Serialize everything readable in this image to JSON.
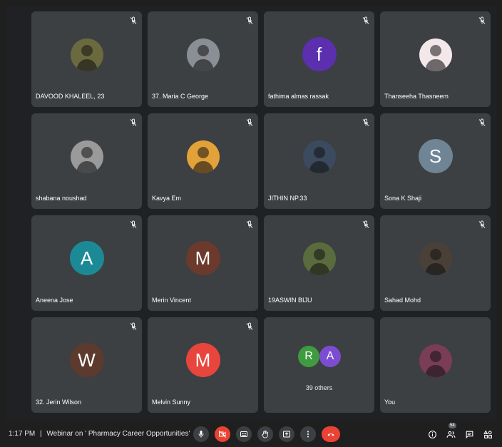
{
  "participants": [
    {
      "name": "DAVOOD KHALEEL, 23",
      "avatar": "photo",
      "color": "#6b6a3f"
    },
    {
      "name": "37. Maria C George",
      "avatar": "photo",
      "color": "#8a8f96"
    },
    {
      "name": "fathima almas rassak",
      "avatar": "letter",
      "letter": "f",
      "color": "#5b2fae"
    },
    {
      "name": "Thanseeha Thasneem",
      "avatar": "photo",
      "color": "#f3e7ea"
    },
    {
      "name": "shabana noushad",
      "avatar": "photo",
      "color": "#9a9a9a"
    },
    {
      "name": "Kavya Em",
      "avatar": "photo",
      "color": "#e3a13a"
    },
    {
      "name": "JITHIN NP.33",
      "avatar": "photo",
      "color": "#3b4a5e"
    },
    {
      "name": "Sona K Shaji",
      "avatar": "letter",
      "letter": "S",
      "color": "#6f8494"
    },
    {
      "name": "Aneena Jose",
      "avatar": "letter",
      "letter": "A",
      "color": "#1c8a96"
    },
    {
      "name": "Merin Vincent",
      "avatar": "letter",
      "letter": "M",
      "color": "#6b3a2c"
    },
    {
      "name": "19ASWIN BIJU",
      "avatar": "photo",
      "color": "#5a6b3e"
    },
    {
      "name": "Sahad Mohd",
      "avatar": "photo",
      "color": "#4a4038"
    },
    {
      "name": "32. Jerin Wilson",
      "avatar": "letter",
      "letter": "W",
      "color": "#5d3a2e"
    },
    {
      "name": "Melvin Sunny",
      "avatar": "letter",
      "letter": "M",
      "color": "#e8453c"
    }
  ],
  "others_tile": {
    "letters": [
      "R",
      "A"
    ],
    "colors": [
      "#3f9b3f",
      "#7c4dd1"
    ],
    "label": "39 others"
  },
  "self_tile": {
    "name": "You",
    "color": "#7a3d55"
  },
  "bottom_bar": {
    "time": "1:17 PM",
    "separator": "|",
    "meeting_title": "Webinar on ' Pharmacy Career Opportunities'",
    "participant_count": "54"
  },
  "icons": {
    "mic": "mic-icon",
    "camera_off": "camera-off-icon",
    "captions": "captions-icon",
    "raise_hand": "hand-icon",
    "present": "present-icon",
    "more": "more-vert-icon",
    "end_call": "end-call-icon",
    "info": "info-icon",
    "people": "people-icon",
    "chat": "chat-icon",
    "activities": "activities-icon"
  }
}
